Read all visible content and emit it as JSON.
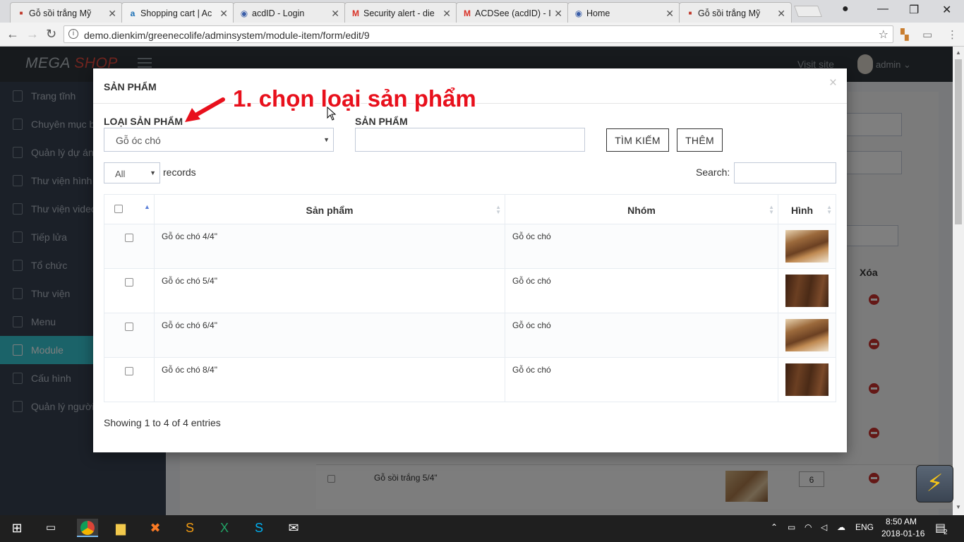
{
  "browser": {
    "tabs": [
      {
        "label": "Gỗ sồi trắng Mỹ",
        "icon": "site-favicon",
        "active": false
      },
      {
        "label": "Shopping cart | Ac",
        "icon": "acd-favicon",
        "active": true
      },
      {
        "label": "acdID - Login",
        "icon": "eye-favicon",
        "active": false
      },
      {
        "label": "Security alert - die",
        "icon": "gmail-favicon",
        "active": false
      },
      {
        "label": "ACDSee (acdID) - I",
        "icon": "gmail-favicon",
        "active": false
      },
      {
        "label": "Home",
        "icon": "eye-favicon",
        "active": false
      },
      {
        "label": "Gỗ sồi trắng Mỹ",
        "icon": "site-favicon",
        "active": false
      }
    ],
    "url": "demo.dienkim/greenecolife/adminsystem/module-item/form/edit/9"
  },
  "app": {
    "logo_part1": "MEGA",
    "logo_part2": "SHOP",
    "visit_site": "Visit site",
    "user": "admin",
    "sidebar": [
      {
        "label": "Trang tĩnh"
      },
      {
        "label": "Chuyên mục bài viết"
      },
      {
        "label": "Quản lý dự án"
      },
      {
        "label": "Thư viện hình ảnh"
      },
      {
        "label": "Thư viện video"
      },
      {
        "label": "Tiếp lửa"
      },
      {
        "label": "Tổ chức"
      },
      {
        "label": "Thư viện"
      },
      {
        "label": "Menu"
      },
      {
        "label": "Module",
        "active": true
      },
      {
        "label": "Cấu hình"
      },
      {
        "label": "Quản lý người dùng"
      }
    ],
    "bg_table": {
      "delete_header": "Xóa",
      "last_row_product": "Gỗ sồi trắng 5/4\"",
      "last_row_order": "6"
    }
  },
  "modal": {
    "title": "SẢN PHẨM",
    "close": "×",
    "annotation": "1. chọn loại sản phẩm",
    "category_label": "LOẠI SẢN PHẨM",
    "category_value": "Gỗ óc chó",
    "product_label": "SẢN PHẨM",
    "product_value": "",
    "search_button": "TÌM KIẾM",
    "add_button": "THÊM",
    "length_value": "All",
    "records_label": "records",
    "search_label": "Search:",
    "search_value": "",
    "columns": [
      "Sản phẩm",
      "Nhóm",
      "Hình"
    ],
    "rows": [
      {
        "product": "Gỗ óc chó 4/4\"",
        "group": "Gỗ óc chó",
        "image": "light-walnut-planks"
      },
      {
        "product": "Gỗ óc chó 5/4\"",
        "group": "Gỗ óc chó",
        "image": "dark-walnut-board"
      },
      {
        "product": "Gỗ óc chó 6/4\"",
        "group": "Gỗ óc chó",
        "image": "light-walnut-planks"
      },
      {
        "product": "Gỗ óc chó 8/4\"",
        "group": "Gỗ óc chó",
        "image": "dark-walnut-board"
      }
    ],
    "info": "Showing 1 to 4 of 4 entries"
  },
  "taskbar": {
    "language": "ENG",
    "time": "8:50 AM",
    "date": "2018-01-16",
    "notifications": "2"
  },
  "colors": {
    "sidebar_active": "#36c6d3",
    "annotation": "#e8101c",
    "delete": "#c9302c"
  }
}
